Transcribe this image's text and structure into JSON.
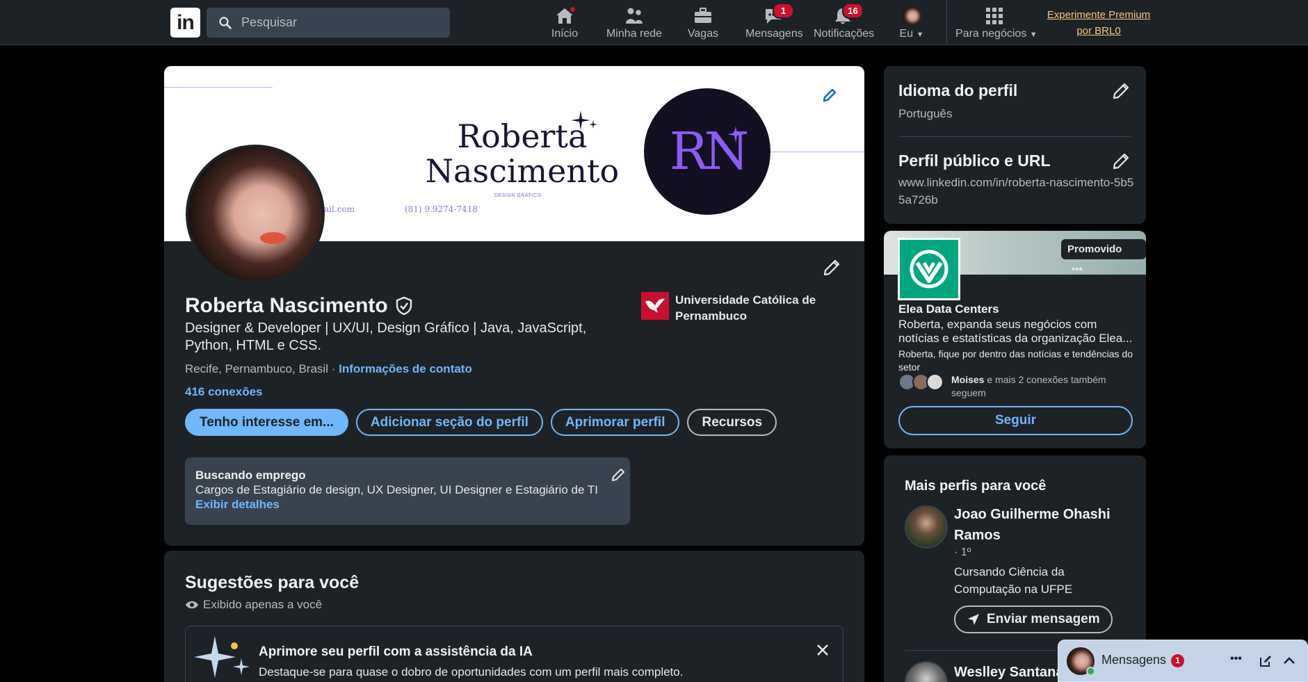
{
  "nav": {
    "logo": "in",
    "search_placeholder": "Pesquisar",
    "items": [
      {
        "label": "Início",
        "icon": "home-icon"
      },
      {
        "label": "Minha rede",
        "icon": "network-icon"
      },
      {
        "label": "Vagas",
        "icon": "briefcase-icon"
      },
      {
        "label": "Mensagens",
        "icon": "messaging-icon",
        "badge": "1"
      },
      {
        "label": "Notificações",
        "icon": "bell-icon",
        "badge": "16"
      },
      {
        "label": "Eu",
        "icon": "avatar"
      },
      {
        "label": "Para negócios",
        "icon": "grid-icon"
      }
    ],
    "premium_line1": "Experimente Premium",
    "premium_line2": "por BRL0"
  },
  "banner": {
    "name_line1": "Roberta",
    "name_line2": "Nascimento",
    "subtitle": "DESIGN GRÁFICO",
    "email": "ail.com",
    "phone": "(81) 9.9274-7418",
    "logo_text": "RN"
  },
  "profile": {
    "name": "Roberta Nascimento",
    "headline": "Designer & Developer | UX/UI, Design Gráfico | Java, JavaScript, Python, HTML e CSS.",
    "location": "Recife, Pernambuco, Brasil",
    "location_sep": " · ",
    "contact_link": "Informações de contato",
    "connections": "416 conexões",
    "education": "Universidade Católica de Pernambuco",
    "buttons": {
      "interest": "Tenho interesse em...",
      "add_section": "Adicionar seção do perfil",
      "improve": "Aprimorar perfil",
      "resources": "Recursos"
    },
    "open_to_work": {
      "title": "Buscando emprego",
      "roles": "Cargos de Estagiário de design, UX Designer, UI Designer e Estagiário de TI",
      "details_link": "Exibir detalhes"
    }
  },
  "suggestions": {
    "title": "Sugestões para você",
    "visibility": "Exibido apenas a você",
    "ai_title": "Aprimore seu perfil com a assistência da IA",
    "ai_desc": "Destaque-se para quase o dobro de oportunidades com um perfil mais completo."
  },
  "sidebar": {
    "language_title": "Idioma do perfil",
    "language_value": "Português",
    "url_title": "Perfil público e URL",
    "url_value": "www.linkedin.com/in/roberta-nascimento-5b55a726b"
  },
  "promo": {
    "tag": "Promovido",
    "company": "Elea Data Centers",
    "desc": "Roberta, expanda seus negócios com notícias e estatísticas da organização Elea...",
    "desc2": "Roberta, fique por dentro das notícias e tendências do setor",
    "follower_name": "Moises",
    "follower_rest": " e mais 2 conexões também seguem",
    "follow_button": "Seguir"
  },
  "more_profiles": {
    "title": "Mais perfis para você",
    "people": [
      {
        "name": "Joao Guilherme Ohashi Ramos",
        "degree": "· 1º",
        "headline": "Cursando Ciência da Computação na UFPE",
        "button": "Enviar mensagem"
      },
      {
        "name": "Weslley Santana"
      }
    ]
  },
  "messaging": {
    "label": "Mensagens",
    "count": "1"
  },
  "colors": {
    "background": "#000000",
    "card": "#1d2226",
    "accent_blue": "#71b7fb",
    "notification_red": "#cb112d",
    "premium_gold": "#f8c77e",
    "brand_purple": "#8b5cf6",
    "elea_green": "#00a67e"
  }
}
